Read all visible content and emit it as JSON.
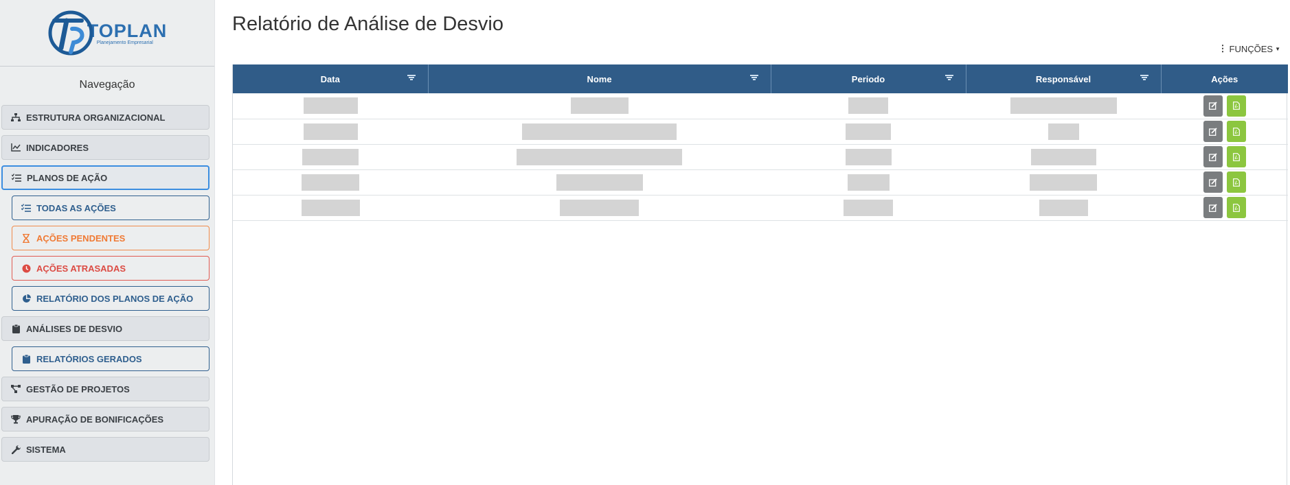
{
  "sidebar": {
    "logo": {
      "name": "TOPLAN",
      "subtitle": "Planejamento Empresarial",
      "brand_color": "#2c6fb0"
    },
    "nav_title": "Navegação",
    "items": [
      {
        "label": "ESTRUTURA ORGANIZACIONAL",
        "icon": "sitemap-icon"
      },
      {
        "label": "INDICADORES",
        "icon": "line-chart-icon"
      },
      {
        "label": "PLANOS DE AÇÃO",
        "icon": "tasks-icon",
        "active": true
      },
      {
        "label": "TODAS AS AÇÕES",
        "icon": "tasks-icon"
      },
      {
        "label": "AÇÕES PENDENTES",
        "icon": "hourglass-icon"
      },
      {
        "label": "AÇÕES ATRASADAS",
        "icon": "clock-icon"
      },
      {
        "label": "RELATÓRIO DOS PLANOS DE AÇÃO",
        "icon": "pie-chart-icon"
      },
      {
        "label": "ANÁLISES DE DESVIO",
        "icon": "clipboard-icon"
      },
      {
        "label": "RELATÓRIOS GERADOS",
        "icon": "clipboard-icon"
      },
      {
        "label": "GESTÃO DE PROJETOS",
        "icon": "project-diagram-icon"
      },
      {
        "label": "APURAÇÃO DE BONIFICAÇÕES",
        "icon": "trophy-icon"
      },
      {
        "label": "SISTEMA",
        "icon": "wrench-icon"
      }
    ]
  },
  "main": {
    "title": "Relatório de Análise de Desvio",
    "funcoes_label": "FUNÇÕES",
    "table": {
      "columns": [
        "Data",
        "Nome",
        "Periodo",
        "Responsável",
        "Ações"
      ],
      "rows": [
        {
          "data": "",
          "nome": "",
          "periodo": "",
          "responsavel": ""
        },
        {
          "data": "",
          "nome": "",
          "periodo": "",
          "responsavel": ""
        },
        {
          "data": "",
          "nome": "",
          "periodo": "",
          "responsavel": ""
        },
        {
          "data": "",
          "nome": "",
          "periodo": "",
          "responsavel": ""
        },
        {
          "data": "",
          "nome": "",
          "periodo": "",
          "responsavel": ""
        }
      ]
    }
  },
  "colors": {
    "header_bg": "#305c88",
    "edit_button": "#7a7d7f",
    "pdf_button": "#8cc63f",
    "active_border": "#3b8de0",
    "pending": "#f07a34",
    "late": "#dc4b43"
  }
}
